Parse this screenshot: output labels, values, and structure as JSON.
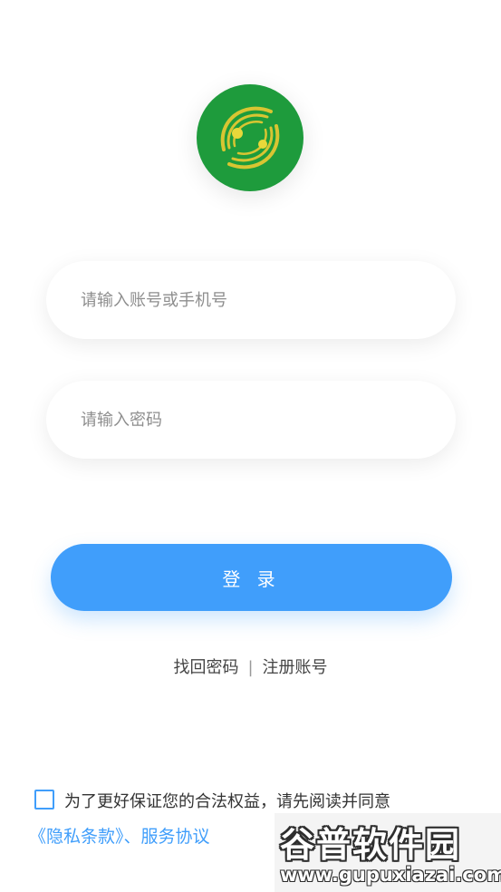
{
  "logo": {
    "icon": "app-logo-icon",
    "colors": {
      "bg": "#1e9b3c",
      "swirl": "#d8c532"
    }
  },
  "login_form": {
    "account_placeholder": "请输入账号或手机号",
    "password_placeholder": "请输入密码",
    "login_label": "登 录",
    "login_color": "#409efb"
  },
  "links": {
    "forgot_password": "找回密码",
    "separator": "|",
    "register": "注册账号"
  },
  "agreement": {
    "text": "为了更好保证您的合法权益，请先阅读并同意",
    "privacy_link": "《隐私条款》",
    "joiner": "、",
    "service_link": "服务协议",
    "checked": false
  },
  "watermark": {
    "title": "谷普软件园",
    "url": "www.gupuxiazai.com"
  }
}
